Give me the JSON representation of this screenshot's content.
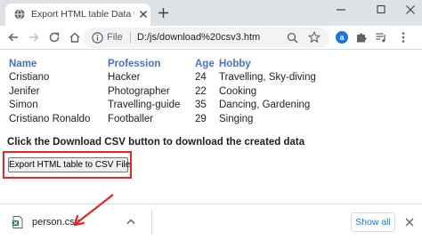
{
  "browser": {
    "tab_title": "Export HTML table Data to CSV u",
    "omnibox": {
      "scheme_label": "File",
      "url": "D:/js/download%20csv3.htm"
    },
    "extension_badge": "a"
  },
  "page": {
    "table": {
      "headers": [
        "Name",
        "Profession",
        "Age",
        "Hobby"
      ],
      "rows": [
        [
          "Cristiano",
          "Hacker",
          "24",
          "Travelling, Sky-diving"
        ],
        [
          "Jenifer",
          "Photographer",
          "22",
          "Cooking"
        ],
        [
          "Simon",
          "Travelling-guide",
          "35",
          "Dancing, Gardening"
        ],
        [
          "Cristiano Ronaldo",
          "Footballer",
          "29",
          "Singing"
        ]
      ]
    },
    "instruction": "Click the Download CSV button to download the created data",
    "export_button_label": "Export HTML table to CSV File"
  },
  "download_bar": {
    "file_name": "person.csv",
    "show_all_label": "Show all"
  },
  "colors": {
    "table_header": "#4472c4",
    "highlight": "#e32626",
    "link_blue": "#1a73e8",
    "tab_strip": "#dee1e6"
  },
  "icons": [
    "globe-icon",
    "close-icon",
    "plus-icon",
    "minimize-icon",
    "maximize-icon",
    "back-icon",
    "forward-icon",
    "reload-icon",
    "info-icon",
    "zoom-icon",
    "star-icon",
    "puzzle-icon",
    "media-icon",
    "menu-icon",
    "file-icon",
    "chevron-up-icon",
    "arrow-annotation"
  ]
}
